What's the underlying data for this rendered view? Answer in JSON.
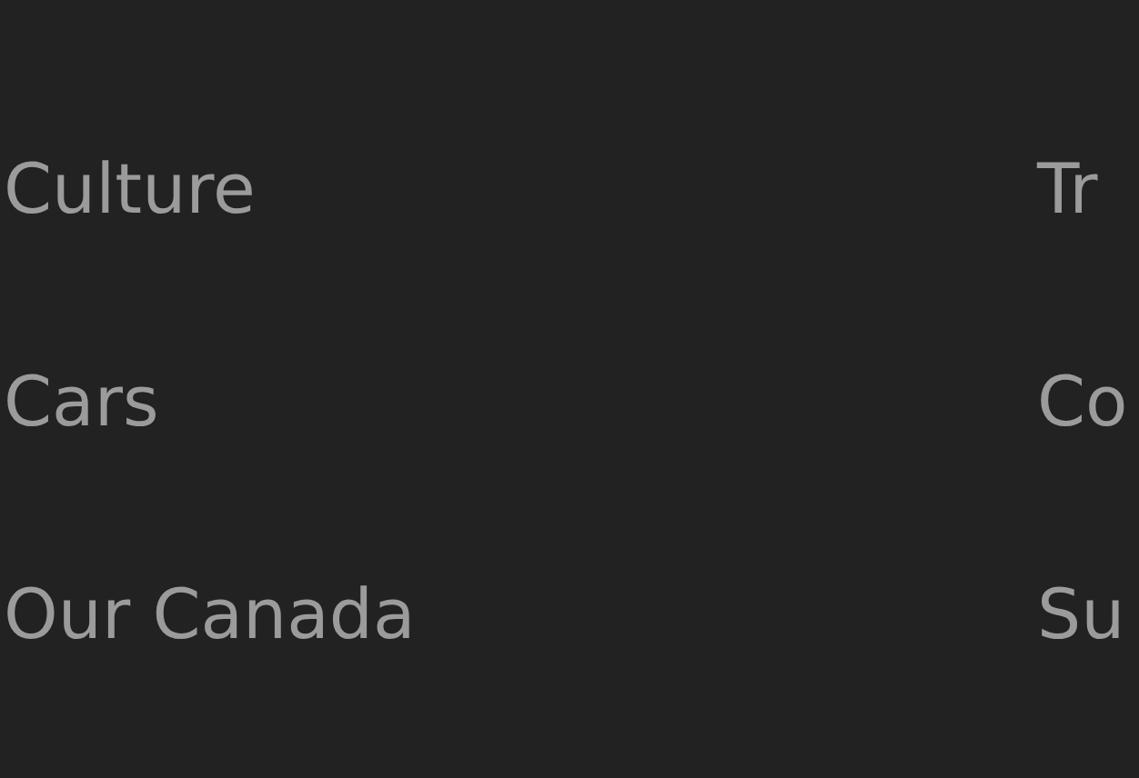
{
  "footer_links": {
    "column_1": [
      "Culture",
      "Cars",
      "Our Canada"
    ],
    "column_2": [
      "Tr",
      "Co",
      "Su"
    ]
  }
}
